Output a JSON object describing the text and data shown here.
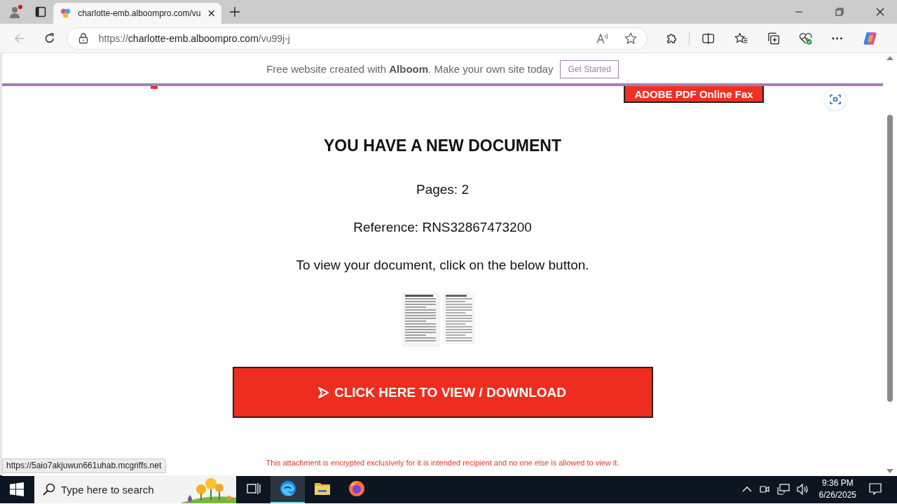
{
  "browser": {
    "tab": {
      "title": "charlotte-emb.alboompro.com/vu",
      "selected": true
    },
    "address": {
      "scheme": "https://",
      "host": "charlotte-emb.alboompro.com",
      "path": "/vu99j-j"
    }
  },
  "banner": {
    "text": "Free website created with **Alboom**. Make your own site today",
    "button": "Get Started"
  },
  "page": {
    "top_button": "ADOBE PDF Online Fax",
    "heading": "YOU HAVE A NEW DOCUMENT",
    "pages": "Pages: 2",
    "reference": "Reference: RNS32867473200",
    "instruction": "To view your document, click on the below button.",
    "cta": "CLICK HERE TO VIEW / DOWNLOAD",
    "footer_note": "This attachment is encrypted exclusively for it is intended recipient and no one else is allowed to view it."
  },
  "status_link": "https://5aio7akjuwun661uhab.mcgriffs.net",
  "taskbar": {
    "search_placeholder": "Type here to search",
    "apps": [
      {
        "kind": "taskview",
        "selected": false
      },
      {
        "kind": "edge",
        "selected": true
      },
      {
        "kind": "explorer",
        "selected": false
      },
      {
        "kind": "firefox",
        "selected": false
      }
    ],
    "time": "9:36 PM",
    "date": "6/26/2025"
  }
}
